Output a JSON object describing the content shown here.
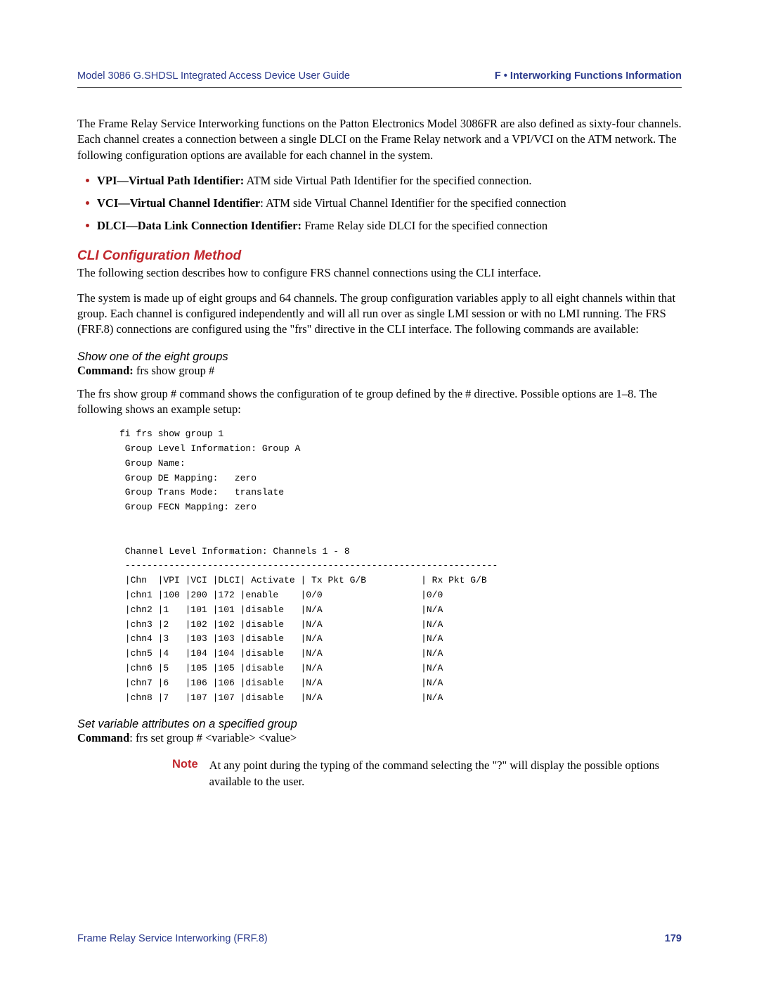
{
  "header": {
    "left": "Model 3086 G.SHDSL Integrated Access Device User Guide",
    "right": "F • Interworking Functions Information"
  },
  "intro": "The Frame Relay Service Interworking functions on the Patton Electronics Model 3086FR are also defined as sixty-four channels. Each channel creates a connection between a single DLCI on the Frame Relay network and a VPI/VCI on the ATM network.  The following configuration options are available for each channel in the system.",
  "bullets": [
    {
      "bold": "VPI—Virtual Path Identifier:",
      "rest": " ATM side Virtual Path Identifier for the specified connection."
    },
    {
      "bold": "VCI—Virtual Channel Identifier",
      "rest": ": ATM side Virtual Channel Identifier for the specified connection"
    },
    {
      "bold": "DLCI—Data Link Connection Identifier:",
      "rest": " Frame Relay side DLCI for the specified connection"
    }
  ],
  "section_heading": "CLI Configuration Method",
  "section_p1": "The following section describes how to configure FRS channel connections using the CLI interface.",
  "section_p2": "The system is made up of eight groups and 64 channels. The group configuration variables apply to all eight channels within that group. Each channel is configured independently and will all run over as single LMI session or with no LMI running. The FRS (FRF.8) connections are configured using the \"frs\" directive in the CLI interface. The following commands are available:",
  "sub1": {
    "title": "Show one of the eight groups",
    "cmd_label": "Command:",
    "cmd_text": " frs show group #",
    "desc": "The frs show group # command shows the configuration of te group defined by the # directive. Possible options are 1–8. The following shows an example setup:"
  },
  "terminal": "fi frs show group 1\n Group Level Information: Group A\n Group Name:\n Group DE Mapping:   zero\n Group Trans Mode:   translate\n Group FECN Mapping: zero\n\n\n Channel Level Information: Channels 1 - 8\n --------------------------------------------------------------------\n |Chn  |VPI |VCI |DLCI| Activate | Tx Pkt G/B          | Rx Pkt G/B\n |chn1 |100 |200 |172 |enable    |0/0                  |0/0\n |chn2 |1   |101 |101 |disable   |N/A                  |N/A\n |chn3 |2   |102 |102 |disable   |N/A                  |N/A\n |chn4 |3   |103 |103 |disable   |N/A                  |N/A\n |chn5 |4   |104 |104 |disable   |N/A                  |N/A\n |chn6 |5   |105 |105 |disable   |N/A                  |N/A\n |chn7 |6   |106 |106 |disable   |N/A                  |N/A\n |chn8 |7   |107 |107 |disable   |N/A                  |N/A",
  "sub2": {
    "title": "Set variable attributes on a specified group",
    "cmd_label": "Command",
    "cmd_text": ": frs set group # <variable> <value>"
  },
  "note": {
    "label": "Note",
    "text": "At any point during the typing of the command selecting the \"?\" will display the possible options available to the user."
  },
  "footer": {
    "left": "Frame Relay Service Interworking (FRF.8)",
    "right": "179"
  }
}
